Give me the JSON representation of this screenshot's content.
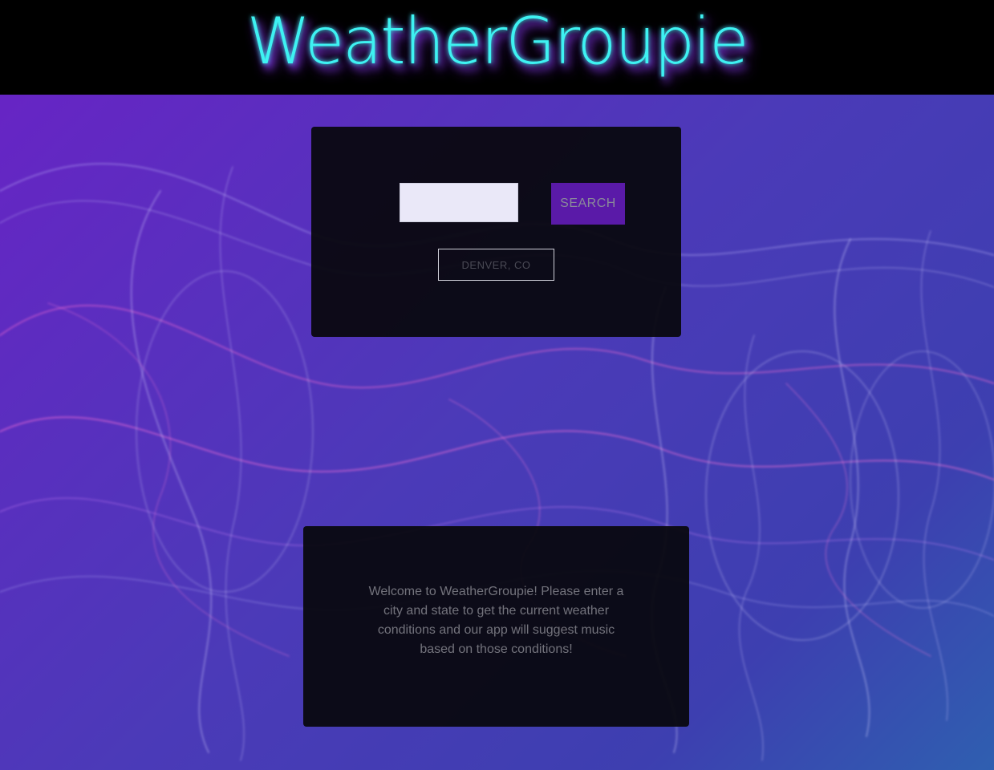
{
  "header": {
    "logo_text": "WeatherGroupie"
  },
  "search": {
    "input_value": "",
    "input_placeholder": "",
    "button_label": "SEARCH",
    "history": [
      "DENVER, CO"
    ]
  },
  "welcome": {
    "message": "Welcome to WeatherGroupie! Please enter a city and state to get the current weather conditions and our app will suggest music based on those conditions!"
  },
  "colors": {
    "header_bg": "#000000",
    "logo": "#3ef2f2",
    "logo_glow": "#8a3cf0",
    "accent_button": "#5a1aa8",
    "card_bg": "#08080c",
    "background_start": "#6a22c6",
    "background_end": "#2f5fb0"
  }
}
